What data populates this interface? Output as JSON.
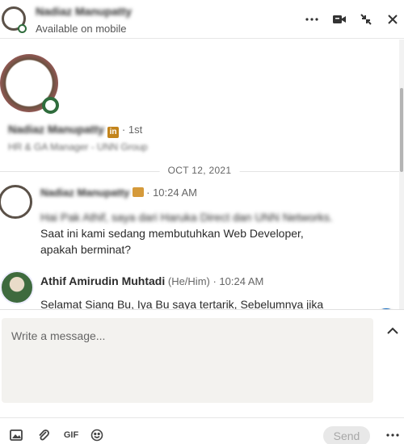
{
  "header": {
    "name": "Nadiaz Manupatty",
    "status": "Available on mobile",
    "icons": [
      "more-options-icon",
      "video-call-icon",
      "compress-icon",
      "close-icon"
    ]
  },
  "profile": {
    "name": "Nadiaz Manupatty",
    "badge": "in",
    "degree": "· 1st",
    "headline": "HR & GA Manager - UNN Group"
  },
  "thread": {
    "date": "OCT 12, 2021",
    "messages": [
      {
        "sender": "Nadiaz Manupatty",
        "time": "· 10:24 AM",
        "lines": [
          "Hai Pak Athif, saya dari Haruka Direct dan UNN Networks.",
          "Saat ini kami sedang membutuhkan Web Developer,",
          "apakah berminat?"
        ]
      },
      {
        "sender": "Athif Amirudin Muhtadi",
        "pronouns": "(He/Him)",
        "time": "· 10:24 AM",
        "lines": [
          "Selamat Siang Bu, Iya Bu saya tertarik, Sebelumnya jika"
        ]
      }
    ]
  },
  "compose": {
    "placeholder": "Write a message...",
    "gif_label": "GIF",
    "send_label": "Send"
  },
  "colors": {
    "accent": "#0a66c2",
    "online": "#2f6c3c",
    "premium": "#c3841b"
  }
}
